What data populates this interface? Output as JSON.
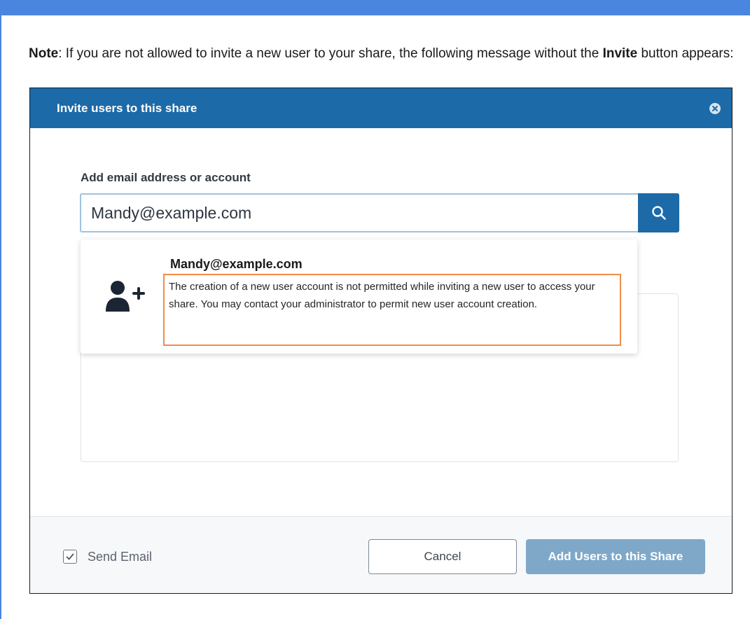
{
  "note": {
    "bold_lead": "Note",
    "text_before": ": If you are not allowed to invite a new user to your share, the following message without the ",
    "bold_word": "Invite",
    "text_after": " button appears:"
  },
  "dialog": {
    "title": "Invite users to this share",
    "close_icon": "close-circle-icon",
    "field_label": "Add email address or account",
    "search_value": "Mandy@example.com",
    "search_icon": "search-icon",
    "suggestion": {
      "icon": "add-user-icon",
      "email": "Mandy@example.com",
      "message": "The creation of a new user account is not permitted while inviting a new user to access your share. You may contact your administrator to permit new user account creation."
    },
    "footer": {
      "send_email_label": "Send Email",
      "send_email_checked": true,
      "cancel_label": "Cancel",
      "add_label": "Add Users to this Share"
    }
  },
  "colors": {
    "header": "#1d6aa8",
    "highlight_border": "#f08a4b",
    "add_button": "#7fa8c8",
    "page_accent": "#4a86e0"
  }
}
